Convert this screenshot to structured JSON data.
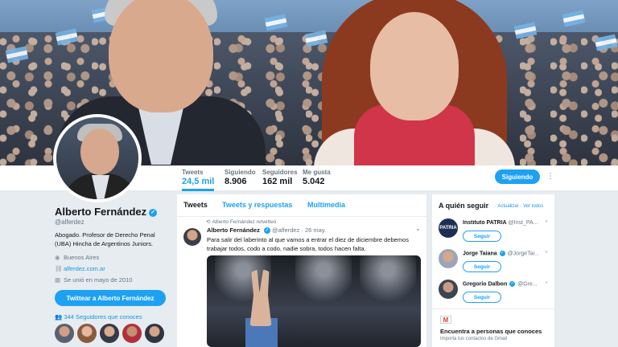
{
  "banner": {
    "description_icon": "banner-photo"
  },
  "nav": {
    "stats": [
      {
        "label": "Tweets",
        "value": "24,5 mil"
      },
      {
        "label": "Siguiendo",
        "value": "8.906"
      },
      {
        "label": "Seguidores",
        "value": "162 mil"
      },
      {
        "label": "Me gusta",
        "value": "5.042"
      }
    ],
    "follow_label": "Siguiendo",
    "more_icon": "⋮"
  },
  "profile": {
    "name": "Alberto Fernández",
    "handle": "@alferdez",
    "bio": "Abogado. Profesor de Derecho Penal (UBA) Hincha de Argentinos Juniors.",
    "location": "Buenos Aires",
    "website": "alferdez.com.ar",
    "joined": "Se unió en mayo de 2010",
    "tweet_to_label": "Twittear a Alberto Fernández",
    "followers_known": "344 Seguidores que conoces"
  },
  "timeline": {
    "tabs": [
      "Tweets",
      "Tweets y respuestas",
      "Multimedia"
    ],
    "retweeted_by": "Alberto Fernández retwitteó",
    "tweet": {
      "name": "Alberto Fernández",
      "handle": "@alferdez",
      "date": "· 26 may.",
      "text": "Para salir del laberinto al que vamos a entrar el diez de diciembre debemos trabajar todos, codo a codo, nadie sobra, todos hacen falta."
    }
  },
  "who_to_follow": {
    "title": "A quién seguir",
    "refresh": "· Actualizar · Ver todos",
    "suggestions": [
      {
        "name": "Instituto PATRIA",
        "handle": "@Inst_PA...",
        "button": "Seguir",
        "verified": false
      },
      {
        "name": "Jorge Taiana",
        "handle": "@JorgeTai...",
        "button": "Seguir",
        "verified": true
      },
      {
        "name": "Gregorio Dalbon",
        "handle": "@Gre...",
        "button": "Seguir",
        "verified": true
      }
    ],
    "dismiss": "×"
  },
  "contacts": {
    "title": "Encuentra a personas que conoces",
    "subtitle": "Importa tus contactos de Gmail",
    "icon_text": "M"
  },
  "colors": {
    "accent": "#1da1f2",
    "link": "#1b95e0",
    "background": "#e6ecf0"
  }
}
